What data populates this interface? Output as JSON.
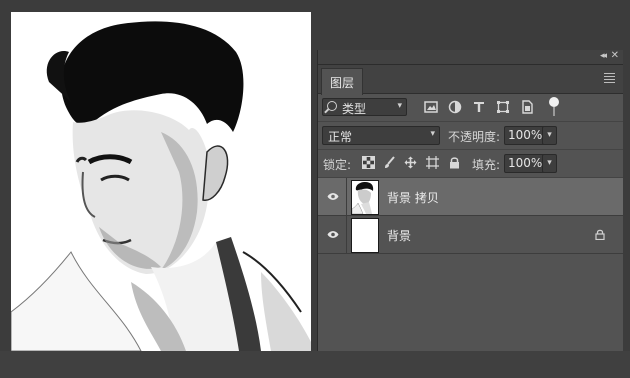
{
  "panel": {
    "tab": "图层",
    "filter": {
      "label": "类型",
      "icons": [
        "image-filter-icon",
        "adjustment-filter-icon",
        "type-filter-icon",
        "shape-filter-icon",
        "smart-object-filter-icon"
      ]
    },
    "blend_mode": "正常",
    "opacity_label": "不透明度:",
    "opacity_value": "100%",
    "lock_label": "锁定:",
    "lock_icons": [
      "lock-transparent-icon",
      "lock-paint-icon",
      "lock-move-icon",
      "lock-artboard-icon",
      "lock-all-icon"
    ],
    "fill_label": "填充:",
    "fill_value": "100%",
    "layers": [
      {
        "name": "背景 拷贝",
        "selected": true,
        "visible": true,
        "locked": false
      },
      {
        "name": "背景",
        "selected": false,
        "visible": true,
        "locked": true
      }
    ]
  }
}
